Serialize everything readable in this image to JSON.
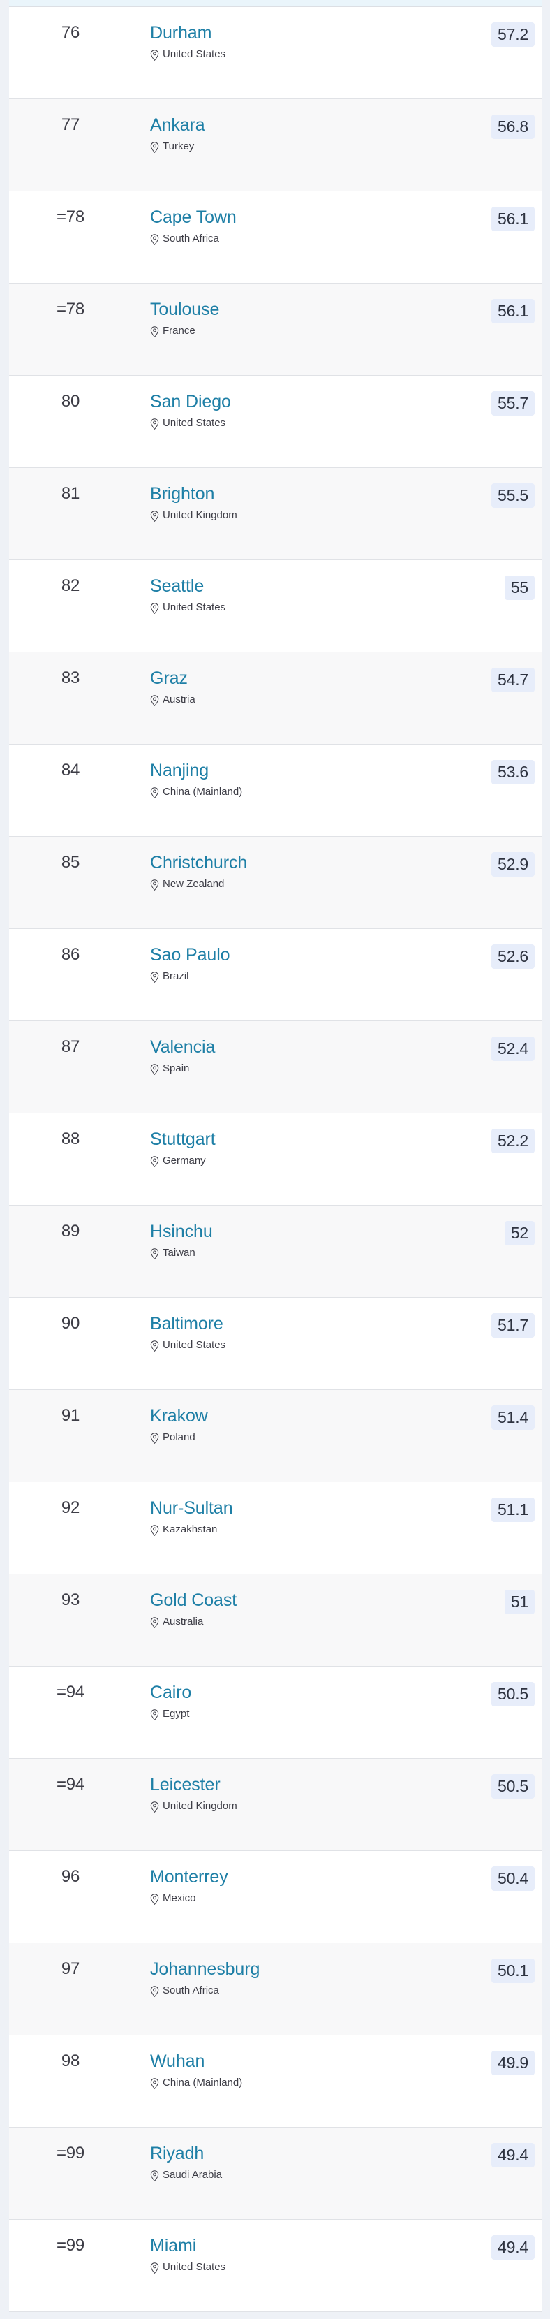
{
  "table": {
    "name": "city-rankings-table",
    "icons": {
      "location": "location-pin-icon"
    },
    "colors": {
      "city_link": "#1e7fa6",
      "score_badge_bg": "#e7edfa",
      "score_text": "#2e3340",
      "rank_text": "#3d3d46",
      "row_bg": "#ffffff",
      "row_alt_bg": "#f8f8f9",
      "page_bg": "#eef1f6",
      "top_band_bg": "#eaf5fb",
      "row_border": "#e0e2e6"
    },
    "rows": [
      {
        "rank": "76",
        "city": "Durham",
        "country": "United States",
        "score": "57.2"
      },
      {
        "rank": "77",
        "city": "Ankara",
        "country": "Turkey",
        "score": "56.8"
      },
      {
        "rank": "=78",
        "city": "Cape Town",
        "country": "South Africa",
        "score": "56.1"
      },
      {
        "rank": "=78",
        "city": "Toulouse",
        "country": "France",
        "score": "56.1"
      },
      {
        "rank": "80",
        "city": "San Diego",
        "country": "United States",
        "score": "55.7"
      },
      {
        "rank": "81",
        "city": "Brighton",
        "country": "United Kingdom",
        "score": "55.5"
      },
      {
        "rank": "82",
        "city": "Seattle",
        "country": "United States",
        "score": "55"
      },
      {
        "rank": "83",
        "city": "Graz",
        "country": "Austria",
        "score": "54.7"
      },
      {
        "rank": "84",
        "city": "Nanjing",
        "country": "China (Mainland)",
        "score": "53.6"
      },
      {
        "rank": "85",
        "city": "Christchurch",
        "country": "New Zealand",
        "score": "52.9"
      },
      {
        "rank": "86",
        "city": "Sao Paulo",
        "country": "Brazil",
        "score": "52.6"
      },
      {
        "rank": "87",
        "city": "Valencia",
        "country": "Spain",
        "score": "52.4"
      },
      {
        "rank": "88",
        "city": "Stuttgart",
        "country": "Germany",
        "score": "52.2"
      },
      {
        "rank": "89",
        "city": "Hsinchu",
        "country": "Taiwan",
        "score": "52"
      },
      {
        "rank": "90",
        "city": "Baltimore",
        "country": "United States",
        "score": "51.7"
      },
      {
        "rank": "91",
        "city": "Krakow",
        "country": "Poland",
        "score": "51.4"
      },
      {
        "rank": "92",
        "city": "Nur-Sultan",
        "country": "Kazakhstan",
        "score": "51.1"
      },
      {
        "rank": "93",
        "city": "Gold Coast",
        "country": "Australia",
        "score": "51"
      },
      {
        "rank": "=94",
        "city": "Cairo",
        "country": "Egypt",
        "score": "50.5"
      },
      {
        "rank": "=94",
        "city": "Leicester",
        "country": "United Kingdom",
        "score": "50.5"
      },
      {
        "rank": "96",
        "city": "Monterrey",
        "country": "Mexico",
        "score": "50.4"
      },
      {
        "rank": "97",
        "city": "Johannesburg",
        "country": "South Africa",
        "score": "50.1"
      },
      {
        "rank": "98",
        "city": "Wuhan",
        "country": "China (Mainland)",
        "score": "49.9"
      },
      {
        "rank": "=99",
        "city": "Riyadh",
        "country": "Saudi Arabia",
        "score": "49.4"
      },
      {
        "rank": "=99",
        "city": "Miami",
        "country": "United States",
        "score": "49.4"
      }
    ]
  }
}
